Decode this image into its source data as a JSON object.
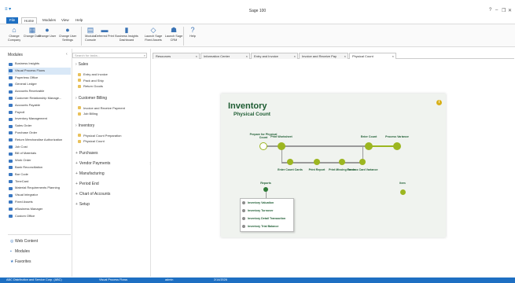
{
  "window": {
    "title": "Sage 100",
    "logo": "≡ ▾",
    "controls": [
      "?",
      "–",
      "❐",
      "✕"
    ]
  },
  "menu": [
    "File",
    "Home",
    "Modules",
    "View",
    "Help"
  ],
  "ribbon": [
    {
      "label": "Change Company",
      "icon": "company-icon",
      "glyph": "⌂"
    },
    {
      "label": "Change Date",
      "icon": "calendar-icon",
      "glyph": "▦"
    },
    {
      "label": "Change User",
      "icon": "user-icon",
      "glyph": "●"
    },
    {
      "label": "Change User Settings",
      "icon": "user-settings-icon",
      "glyph": "●"
    },
    {
      "label": "Modular Console",
      "icon": "console-icon",
      "glyph": "▤"
    },
    {
      "label": "Deferred Print",
      "icon": "printer-icon",
      "glyph": "▬"
    },
    {
      "label": "Business Insights Dashboard",
      "icon": "dashboard-icon",
      "glyph": "▮"
    },
    {
      "label": "Launch Sage Fixed Assets",
      "icon": "fixed-assets-icon",
      "glyph": "◇"
    },
    {
      "label": "Launch Sage CRM",
      "icon": "crm-icon",
      "glyph": "☗"
    },
    {
      "label": "Help",
      "icon": "help-icon",
      "glyph": "?"
    }
  ],
  "modules": {
    "title": "Modules",
    "collapse": "‹",
    "items": [
      "Business Insights",
      "Visual Process Flows",
      "Paperless Office",
      "General Ledger",
      "Accounts Receivable",
      "Customer Relationship Manage...",
      "Accounts Payable",
      "Payroll",
      "Inventory Management",
      "Sales Order",
      "Purchase Order",
      "Return Merchandise Authorization",
      "Job Cost",
      "Bill of Materials",
      "Work Order",
      "Bank Reconciliation",
      "Bar Code",
      "TimeCard",
      "Material Requirements Planning",
      "Visual Integrator",
      "Fixed Assets",
      "eBusiness Manager",
      "Custom Office"
    ],
    "selected_index": 1,
    "bottom_links": [
      "Web Content",
      "Modules",
      "Favorites"
    ]
  },
  "tasks": {
    "search_placeholder": "Search for tasks...",
    "groups": [
      {
        "label": "Sales",
        "expanded": true,
        "items": [
          "Entry and Invoice",
          "Pack and Ship",
          "Return Goods"
        ]
      },
      {
        "label": "Customer Billing",
        "expanded": true,
        "items": [
          "Invoice and Receive Payment",
          "Job Billing"
        ]
      },
      {
        "label": "Inventory",
        "expanded": true,
        "items": [
          "Physical Count Preparation",
          "Physical Count"
        ]
      },
      {
        "label": "Purchases",
        "expanded": false,
        "items": []
      },
      {
        "label": "Vendor Payments",
        "expanded": false,
        "items": []
      },
      {
        "label": "Manufacturing",
        "expanded": false,
        "items": []
      },
      {
        "label": "Period End",
        "expanded": false,
        "items": []
      },
      {
        "label": "Chart of Accounts",
        "expanded": false,
        "items": []
      },
      {
        "label": "Setup",
        "expanded": false,
        "items": []
      }
    ]
  },
  "tabs": [
    {
      "label": "Resources",
      "active": false
    },
    {
      "label": "Information Center",
      "active": false
    },
    {
      "label": "Entry and Invoice",
      "active": false
    },
    {
      "label": "Invoice and Receive Pay",
      "active": false
    },
    {
      "label": "Physical Count",
      "active": true
    }
  ],
  "flow": {
    "title": "Inventory",
    "subtitle": "Physical Count",
    "steps_top": [
      "Prepare for Physical Count",
      "Print Worksheet",
      "Enter Count",
      "Process Variance"
    ],
    "steps_bottom": [
      "Enter Count Cards",
      "Print Report",
      "Print Missing Cards",
      "Process Card Variance"
    ],
    "reports_label": "Reports",
    "reports": [
      "Inventory Valuation",
      "Inventory Turnover",
      "Inventory Detail Transaction",
      "Inventory Trial Balance"
    ],
    "tasks_label": "Item"
  },
  "status": [
    "ABC Distribution and Service Corp. (ABC)",
    "Visual Process Flows",
    "admin",
    "2/14/2026"
  ]
}
